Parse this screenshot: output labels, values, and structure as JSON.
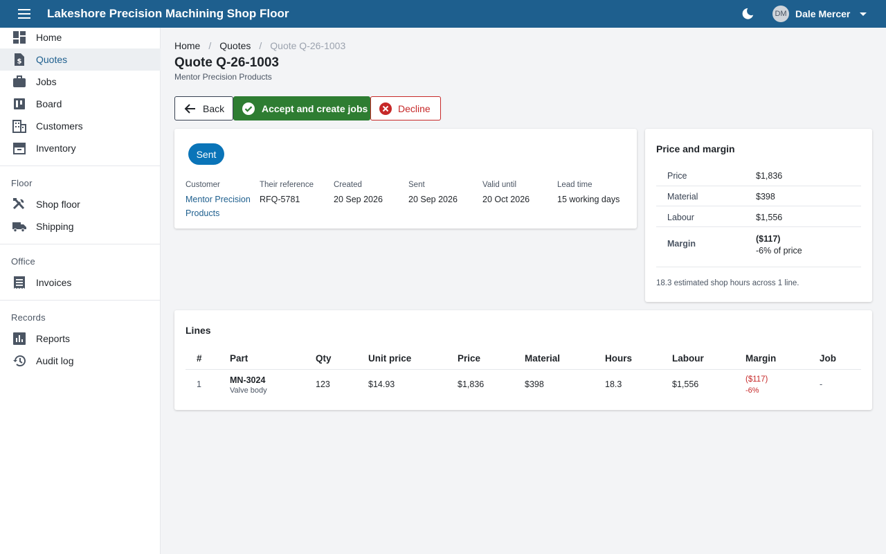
{
  "app": {
    "title": "Lakeshore Precision Machining Shop Floor"
  },
  "user": {
    "initials": "DM",
    "name": "Dale Mercer"
  },
  "sidebar": {
    "items": [
      {
        "label": "Home",
        "icon": "dashboard-icon"
      },
      {
        "label": "Quotes",
        "icon": "document-dollar-icon",
        "active": true
      },
      {
        "label": "Jobs",
        "icon": "briefcase-icon"
      },
      {
        "label": "Board",
        "icon": "kanban-board-icon"
      },
      {
        "label": "Customers",
        "icon": "building-icon"
      },
      {
        "label": "Inventory",
        "icon": "archive-box-icon"
      }
    ],
    "sections": [
      {
        "label": "Floor",
        "items": [
          {
            "label": "Shop floor",
            "icon": "tools-icon"
          },
          {
            "label": "Shipping",
            "icon": "truck-icon"
          }
        ]
      },
      {
        "label": "Office",
        "items": [
          {
            "label": "Invoices",
            "icon": "receipt-icon"
          }
        ]
      },
      {
        "label": "Records",
        "items": [
          {
            "label": "Reports",
            "icon": "bar-chart-icon"
          },
          {
            "label": "Audit log",
            "icon": "history-icon"
          }
        ]
      }
    ]
  },
  "breadcrumb": {
    "home": "Home",
    "quotes": "Quotes",
    "current": "Quote Q-26-1003",
    "sep": "/"
  },
  "page": {
    "title": "Quote Q-26-1003",
    "subtitle": "Mentor Precision Products"
  },
  "actions": {
    "back": "Back",
    "accept": "Accept and create jobs",
    "decline": "Decline"
  },
  "summary": {
    "status": "Sent",
    "fields": [
      {
        "label": "Customer",
        "value": "Mentor Precision Products",
        "link": true
      },
      {
        "label": "Their reference",
        "value": "RFQ-5781"
      },
      {
        "label": "Created",
        "value": "20 Sep 2026"
      },
      {
        "label": "Sent",
        "value": "20 Sep 2026"
      },
      {
        "label": "Valid until",
        "value": "20 Oct 2026"
      },
      {
        "label": "Lead time",
        "value": "15 working days"
      }
    ]
  },
  "price_margin": {
    "heading": "Price and margin",
    "rows": [
      {
        "label": "Price",
        "value": "$1,836"
      },
      {
        "label": "Material",
        "value": "$398"
      },
      {
        "label": "Labour",
        "value": "$1,556"
      }
    ],
    "margin": {
      "label": "Margin",
      "value": "($117)",
      "note": "-6% of price"
    },
    "footnote": "18.3 estimated shop hours across 1 line."
  },
  "lines": {
    "heading": "Lines",
    "columns": [
      "#",
      "Part",
      "Qty",
      "Unit price",
      "Price",
      "Material",
      "Hours",
      "Labour",
      "Margin",
      "Job"
    ],
    "rows": [
      {
        "num": "1",
        "part": "MN-3024",
        "part_desc": "Valve body",
        "qty": "123",
        "unit_price": "$14.93",
        "price": "$1,836",
        "material": "$398",
        "hours": "18.3",
        "labour": "$1,556",
        "margin": "($117)",
        "margin_pct": "-6%",
        "job": "-"
      }
    ]
  },
  "colors": {
    "topbar": "#1e5f8e",
    "accept": "#2e7d32",
    "decline": "#c62828",
    "badge": "#0a74b8",
    "negative": "#c62828"
  }
}
